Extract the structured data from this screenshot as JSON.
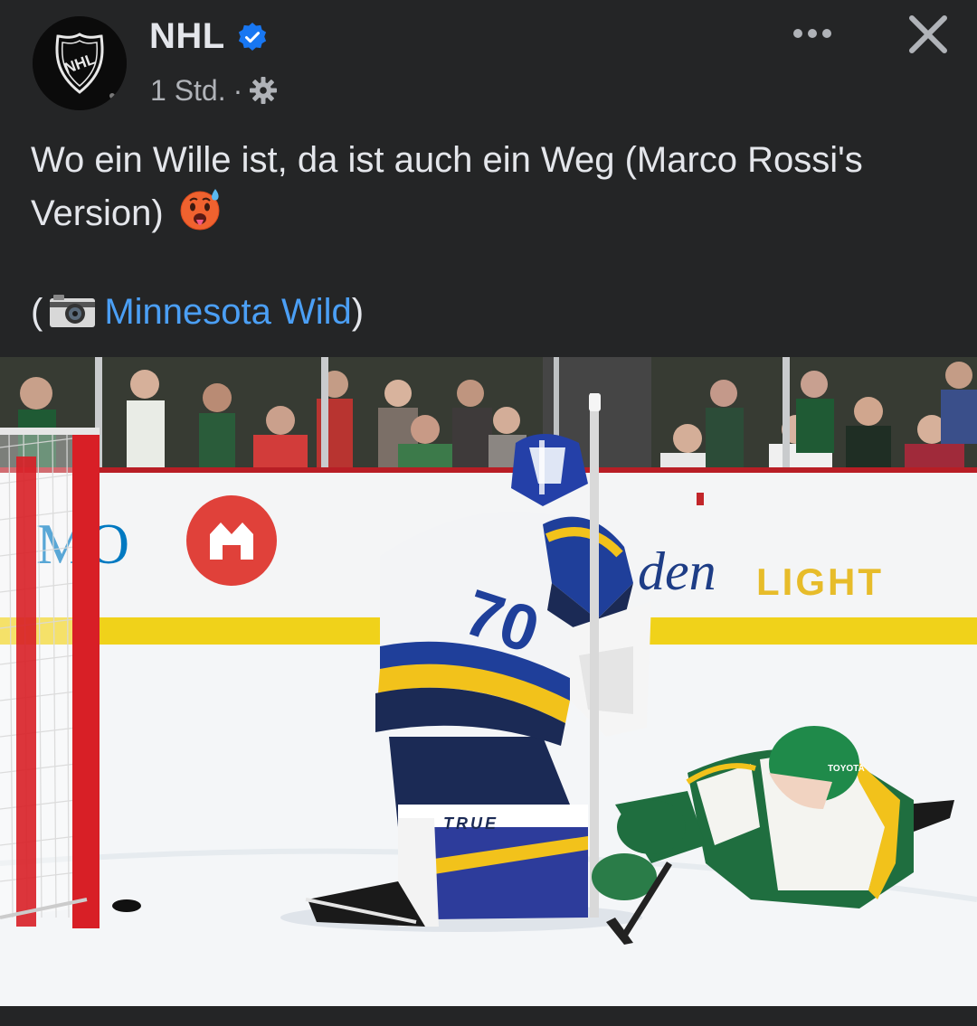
{
  "post": {
    "page_name": "NHL",
    "time": "1 Std.",
    "separator": "·",
    "text": "Wo ein Wille ist, da ist auch ein Weg (Marco Rossi's Version)",
    "caption_open": "(",
    "caption_link": "Minnesota Wild",
    "caption_close": ")"
  },
  "avatar_logo_text": "NHL",
  "photo": {
    "board_left_text": "MO",
    "board_right_text": "den",
    "board_light_text": "LIGHT",
    "pad_brand_text": "TRUE",
    "helmet_sponsor_text": "TOYOTA"
  },
  "icons": {
    "verified": "verified-badge-icon",
    "privacy": "gear-icon",
    "more": "more-dots-icon",
    "close": "close-icon",
    "emoji": "hot-face-emoji-icon",
    "camera": "camera-icon"
  },
  "colors": {
    "background": "#242526",
    "text": "#e4e6eb",
    "secondary_text": "#b0b3b8",
    "link": "#4b9ff5",
    "verified": "#1877f2"
  }
}
